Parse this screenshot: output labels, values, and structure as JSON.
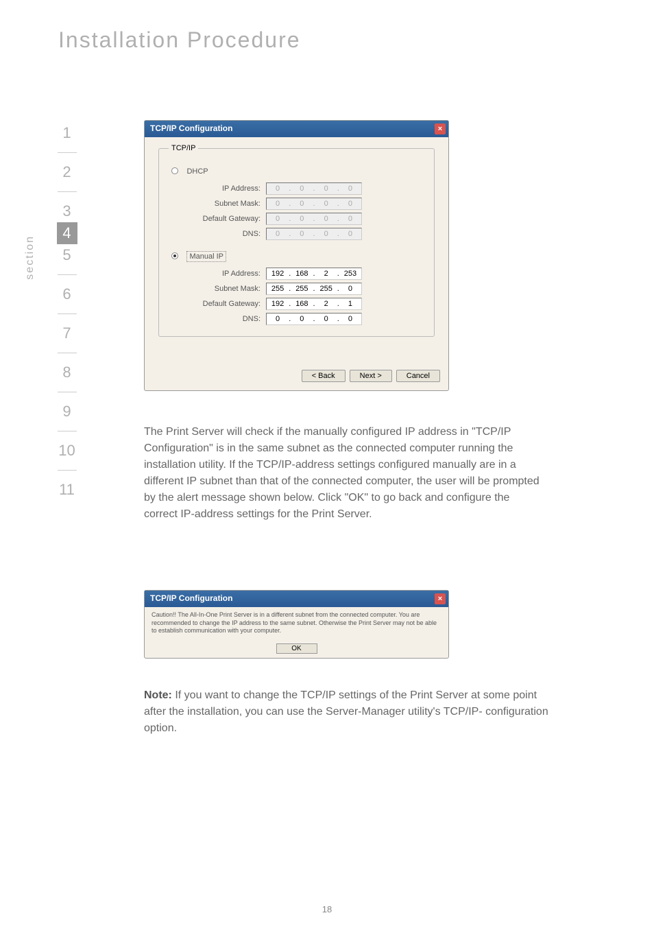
{
  "page": {
    "title": "Installation Procedure",
    "number": "18"
  },
  "nav": {
    "section_label": "section",
    "items": [
      "1",
      "2",
      "3",
      "4",
      "5",
      "6",
      "7",
      "8",
      "9",
      "10",
      "11"
    ],
    "active_index": 3
  },
  "dialog1": {
    "title": "TCP/IP Configuration",
    "legend": "TCP/IP",
    "dhcp_label": "DHCP",
    "manual_label": "Manual IP",
    "rows": {
      "ip_label": "IP Address:",
      "subnet_label": "Subnet Mask:",
      "gateway_label": "Default Gateway:",
      "dns_label": "DNS:"
    },
    "dhcp": {
      "ip": [
        "0",
        "0",
        "0",
        "0"
      ],
      "subnet": [
        "0",
        "0",
        "0",
        "0"
      ],
      "gateway": [
        "0",
        "0",
        "0",
        "0"
      ],
      "dns": [
        "0",
        "0",
        "0",
        "0"
      ]
    },
    "manual": {
      "ip": [
        "192",
        "168",
        "2",
        "253"
      ],
      "subnet": [
        "255",
        "255",
        "255",
        "0"
      ],
      "gateway": [
        "192",
        "168",
        "2",
        "1"
      ],
      "dns": [
        "0",
        "0",
        "0",
        "0"
      ]
    },
    "buttons": {
      "back": "< Back",
      "next": "Next >",
      "cancel": "Cancel"
    }
  },
  "body_paragraph": "The Print Server will check if the manually configured IP address in \"TCP/IP Configuration\" is in the same subnet as the connected computer running the installation utility. If the TCP/IP-address settings configured manually are in a different IP subnet than that of the connected computer, the user will be prompted by the alert message shown below. Click \"OK\" to go back and configure the correct IP-address settings for the Print Server.",
  "alert": {
    "title": "TCP/IP Configuration",
    "text": "Caution!! The All-In-One Print Server is in a different subnet from the connected computer. You are recommended to change the IP address to the same subnet. Otherwise the Print Server may not be able to establish communication with your computer.",
    "ok": "OK"
  },
  "note": {
    "label": "Note:",
    "text": " If you want to change the TCP/IP settings of the Print Server at some point after the installation, you can use the Server-Manager utility's TCP/IP- configuration option."
  }
}
